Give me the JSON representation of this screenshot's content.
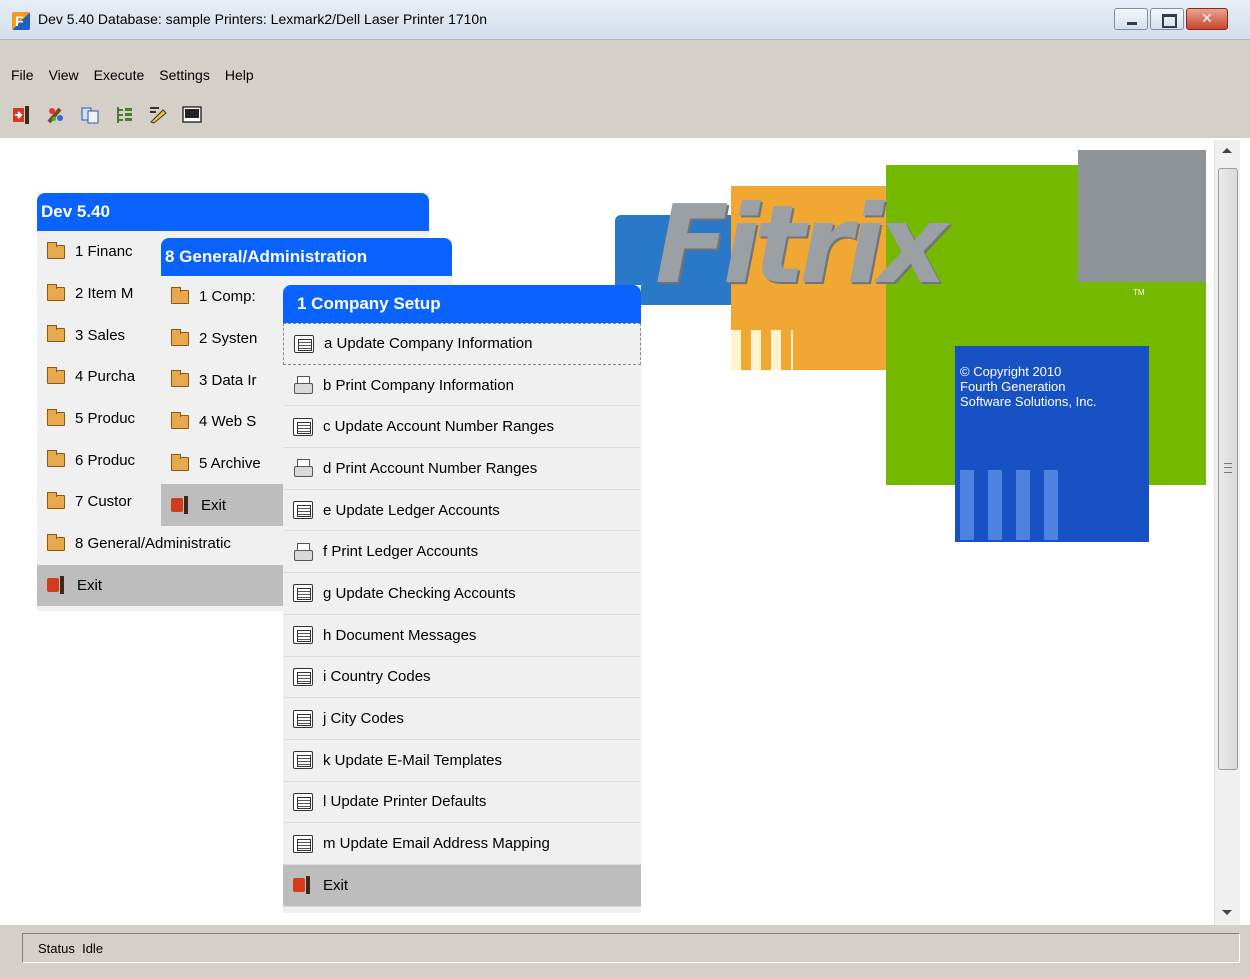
{
  "window": {
    "title": "Dev 5.40 Database: sample Printers: Lexmark2/Dell Laser Printer 1710n"
  },
  "menubar": [
    "File",
    "View",
    "Execute",
    "Settings",
    "Help"
  ],
  "toolbar": [
    "exit-icon",
    "paint-icon",
    "windows-icon",
    "tree-icon",
    "edit-icon",
    "console-icon"
  ],
  "menu1": {
    "title": "Dev 5.40",
    "items": [
      "1 Financ",
      "2 Item M",
      "3 Sales",
      "4 Purcha",
      "5 Produc",
      "6 Produc",
      "7 Custor",
      "8 General/Administratic"
    ],
    "exit": "Exit"
  },
  "menu2": {
    "title": "8 General/Administration",
    "items": [
      "1 Comp:",
      "2 Systen",
      "3 Data Ir",
      "4 Web S",
      "5 Archive"
    ],
    "exit": "Exit"
  },
  "menu3": {
    "title": "1 Company Setup",
    "items": [
      {
        "label": "a  Update Company Information",
        "icon": "form-icon"
      },
      {
        "label": "b  Print Company Information",
        "icon": "printer-icon"
      },
      {
        "label": "c  Update Account Number Ranges",
        "icon": "form-icon"
      },
      {
        "label": "d  Print Account Number Ranges",
        "icon": "printer-icon"
      },
      {
        "label": "e  Update Ledger Accounts",
        "icon": "form-icon"
      },
      {
        "label": "f  Print Ledger Accounts",
        "icon": "printer-icon"
      },
      {
        "label": "g  Update Checking Accounts",
        "icon": "form-icon"
      },
      {
        "label": "h  Document Messages",
        "icon": "form-icon"
      },
      {
        "label": "i  Country Codes",
        "icon": "form-icon"
      },
      {
        "label": "j  City Codes",
        "icon": "form-icon"
      },
      {
        "label": "k  Update E-Mail Templates",
        "icon": "form-icon"
      },
      {
        "label": "l  Update Printer Defaults",
        "icon": "form-icon"
      },
      {
        "label": "m  Update Email Address Mapping",
        "icon": "form-icon"
      }
    ],
    "exit": "Exit"
  },
  "logo": {
    "wordmark": "Fitrix",
    "tm": "TM",
    "copyright": "© Copyright 2010\nFourth Generation\nSoftware Solutions, Inc."
  },
  "status": {
    "label": "Status",
    "value": "Idle"
  },
  "colors": {
    "menu_header": "#0a63ff",
    "logo_orange": "#f0a832",
    "logo_green": "#74b800",
    "logo_blue": "#1751c4",
    "logo_gray": "#8e9497"
  }
}
